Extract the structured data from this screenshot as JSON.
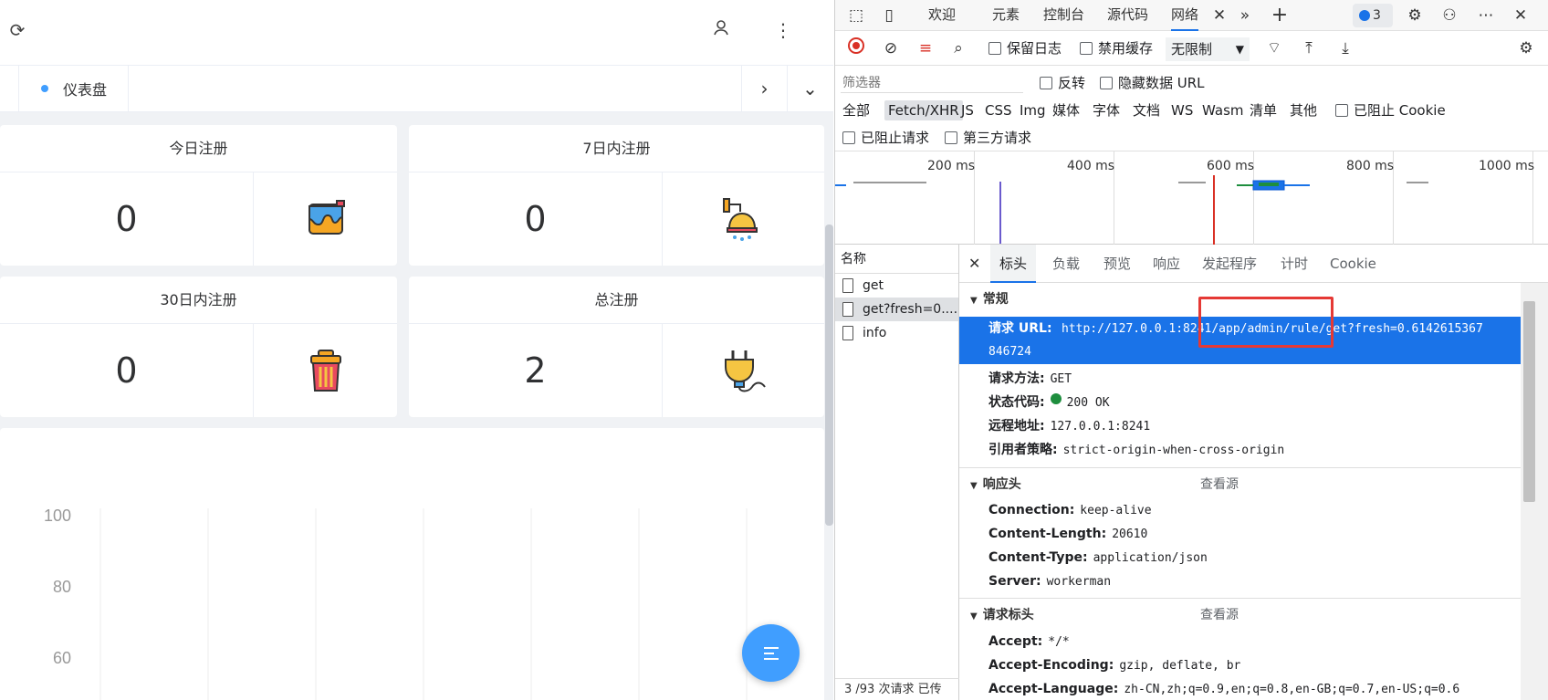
{
  "app": {
    "tab": {
      "label": "仪表盘"
    },
    "cards": [
      {
        "title": "今日注册",
        "value": "0",
        "icon": "paint-bucket-icon"
      },
      {
        "title": "7日内注册",
        "value": "0",
        "icon": "ceiling-lamp-icon"
      },
      {
        "title": "30日内注册",
        "value": "0",
        "icon": "trash-can-icon"
      },
      {
        "title": "总注册",
        "value": "2",
        "icon": "power-plug-icon"
      }
    ],
    "chart_data": {
      "type": "line",
      "yticks": [
        100,
        80,
        60
      ],
      "ylim": [
        60,
        100
      ],
      "grid": true
    },
    "fab_icon": "menu-icon"
  },
  "devtools": {
    "tabs": [
      "欢迎",
      "元素",
      "控制台",
      "源代码",
      "网络"
    ],
    "issue_count": "3",
    "toolbar": {
      "preserve_log": "保留日志",
      "disable_cache": "禁用缓存",
      "throttle": "无限制"
    },
    "filter": {
      "placeholder": "筛选器",
      "invert": "反转",
      "hide_data_urls": "隐藏数据 URL",
      "types": [
        "全部",
        "Fetch/XHR",
        "JS",
        "CSS",
        "Img",
        "媒体",
        "字体",
        "文档",
        "WS",
        "Wasm",
        "清单",
        "其他"
      ],
      "blocked_cookies": "已阻止 Cookie",
      "blocked_requests": "已阻止请求",
      "third_party": "第三方请求"
    },
    "overview": {
      "labels": [
        "200 ms",
        "400 ms",
        "600 ms",
        "800 ms",
        "1000 ms"
      ]
    },
    "requests": {
      "header": "名称",
      "items": [
        "get",
        "get?fresh=0....",
        "info"
      ],
      "status": "3 /93 次请求 已传"
    },
    "detail": {
      "tabs": [
        "标头",
        "负载",
        "预览",
        "响应",
        "发起程序",
        "计时",
        "Cookie"
      ],
      "general": {
        "title": "常规",
        "url_key": "请求 URL:",
        "url_line1": "http://127.0.0.1:8241/app/admin/rule/get?fresh=0.6142615367",
        "url_line2": "846724",
        "method_key": "请求方法:",
        "method": "GET",
        "status_key": "状态代码:",
        "status": "200 OK",
        "remote_key": "远程地址:",
        "remote": "127.0.0.1:8241",
        "referrer_key": "引用者策略:",
        "referrer": "strict-origin-when-cross-origin"
      },
      "response": {
        "title": "响应头",
        "view_source": "查看源",
        "rows": [
          {
            "k": "Connection:",
            "v": "keep-alive"
          },
          {
            "k": "Content-Length:",
            "v": "20610"
          },
          {
            "k": "Content-Type:",
            "v": "application/json"
          },
          {
            "k": "Server:",
            "v": "workerman"
          }
        ]
      },
      "request": {
        "title": "请求标头",
        "view_source": "查看源",
        "rows": [
          {
            "k": "Accept:",
            "v": "*/*"
          },
          {
            "k": "Accept-Encoding:",
            "v": "gzip, deflate, br"
          },
          {
            "k": "Accept-Language:",
            "v": "zh-CN,zh;q=0.9,en;q=0.8,en-GB;q=0.7,en-US;q=0.6"
          }
        ]
      }
    }
  }
}
